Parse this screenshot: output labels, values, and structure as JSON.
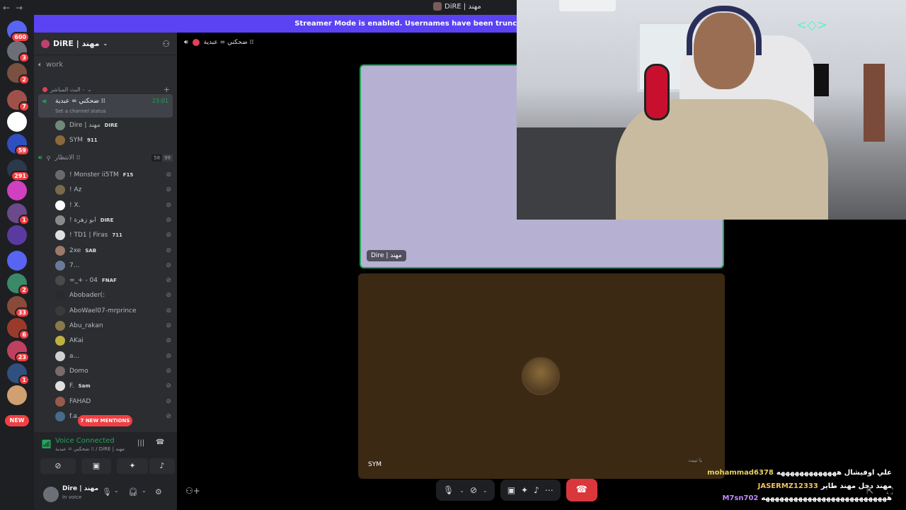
{
  "titlebar": {
    "title": "DiRE | مهند"
  },
  "banner": {
    "text": "Streamer Mode is enabled. Usernames have been trunc"
  },
  "guilds": [
    {
      "name": "discord-home",
      "badge": "600",
      "color": "#5865f2"
    },
    {
      "name": "guild-1",
      "badge": "3",
      "color": "#6d6f78"
    },
    {
      "name": "guild-2",
      "badge": "2",
      "color": "#7a5040"
    },
    {
      "name": "guild-3",
      "badge": "7",
      "color": "#a0504a"
    },
    {
      "name": "guild-4",
      "badge": "",
      "color": "#ffffff"
    },
    {
      "name": "guild-5",
      "badge": "59",
      "color": "#3050c0"
    },
    {
      "name": "guild-6",
      "badge": "291",
      "color": "#2a3a4a"
    },
    {
      "name": "guild-7",
      "badge": "",
      "color": "#d040c0"
    },
    {
      "name": "guild-8",
      "badge": "1",
      "color": "#6a4a8a"
    },
    {
      "name": "guild-9",
      "badge": "",
      "color": "#5a3aa0"
    },
    {
      "name": "folder",
      "badge": "",
      "color": "#5865f2"
    },
    {
      "name": "guild-10",
      "badge": "2",
      "color": "#3a8a6a"
    },
    {
      "name": "guild-11",
      "badge": "33",
      "color": "#8a4a3a"
    },
    {
      "name": "guild-12",
      "badge": "6",
      "color": "#9a3a2a"
    },
    {
      "name": "guild-13",
      "badge": "23",
      "color": "#c04060"
    },
    {
      "name": "guild-14",
      "badge": "1",
      "color": "#305080"
    },
    {
      "name": "guild-15",
      "badge": "",
      "color": "#d0a070"
    }
  ],
  "guild_new_label": "NEW",
  "server": {
    "name": "DiRE | مهند"
  },
  "channels": {
    "work": "work",
    "category": "البث المباشر -",
    "active": {
      "name": "ضحكني = عبدية ⁞⁞",
      "timer": "23:01",
      "status": "Set a channel status"
    },
    "active_members": [
      {
        "name": "Dire | مهند",
        "tag": "DIRE",
        "color": "#6d8a7a"
      },
      {
        "name": "SYM",
        "tag": "911",
        "color": "#8a6a3a"
      }
    ],
    "second": {
      "name": "الانتظار ⁞⁞",
      "count": "58",
      "limit": "99"
    },
    "waiting_members": [
      {
        "name": "! Monster ii5TM",
        "tag": "F15",
        "color": "#6a6a6a"
      },
      {
        "name": "! Az",
        "tag": "",
        "color": "#7a6a4a"
      },
      {
        "name": "! X.",
        "tag": "",
        "color": "#ffffff"
      },
      {
        "name": "! ابو زهرة",
        "tag": "DIRE",
        "color": "#8a8a8a"
      },
      {
        "name": "! TD1 | Firas",
        "tag": "711",
        "color": "#e0e0e0"
      },
      {
        "name": "2xe",
        "tag": "SAB",
        "color": "#9a7a6a"
      },
      {
        "name": "7...",
        "tag": "",
        "color": "#6a7a9a"
      },
      {
        "name": "=_+ - 04",
        "tag": "FNAF",
        "color": "#4a4a4a"
      },
      {
        "name": "Abobader(:",
        "tag": "",
        "color": "#2a2a2a"
      },
      {
        "name": "AboWael07-mrprince",
        "tag": "",
        "color": "#3a3a3a"
      },
      {
        "name": "Abu_rakan",
        "tag": "",
        "color": "#8a7a4a"
      },
      {
        "name": "AKai",
        "tag": "",
        "color": "#c0b040"
      },
      {
        "name": "a...",
        "tag": "",
        "color": "#d0d0d0"
      },
      {
        "name": "Domo",
        "tag": "",
        "color": "#7a6a6a"
      },
      {
        "name": "F.",
        "tag": "Sam",
        "color": "#e0e0e0"
      },
      {
        "name": "FAHAD",
        "tag": "",
        "color": "#9a5a4a"
      },
      {
        "name": "f.a.",
        "tag": "",
        "color": "#4a6a8a"
      }
    ]
  },
  "mentions_label": "7 NEW MENTIONS",
  "voice": {
    "title": "Voice Connected",
    "subtitle": "ضحكني = عبدية ⁞⁞ / DiRE | مهند"
  },
  "user": {
    "name": "Dire | مهند",
    "status": "In voice"
  },
  "stage": {
    "channel": "ضحكني = عبدية ⁞⁞",
    "tile1_label": "Dire | مهند",
    "tile2_label": "SYM"
  },
  "chat": {
    "notice": "يا تبيت",
    "messages": [
      {
        "user": "mohammad6378",
        "text": "علي اوفيشال هههههههههههههه"
      },
      {
        "user": "JASERMZ12333",
        "text": "مهند دخل مهند طاير"
      },
      {
        "user": "M7sn702",
        "text": "هههههههههههههههههههههههههههه"
      }
    ]
  },
  "colors": {
    "accent": "#5b42f3",
    "voice_green": "#23a55a",
    "danger": "#da373c"
  }
}
